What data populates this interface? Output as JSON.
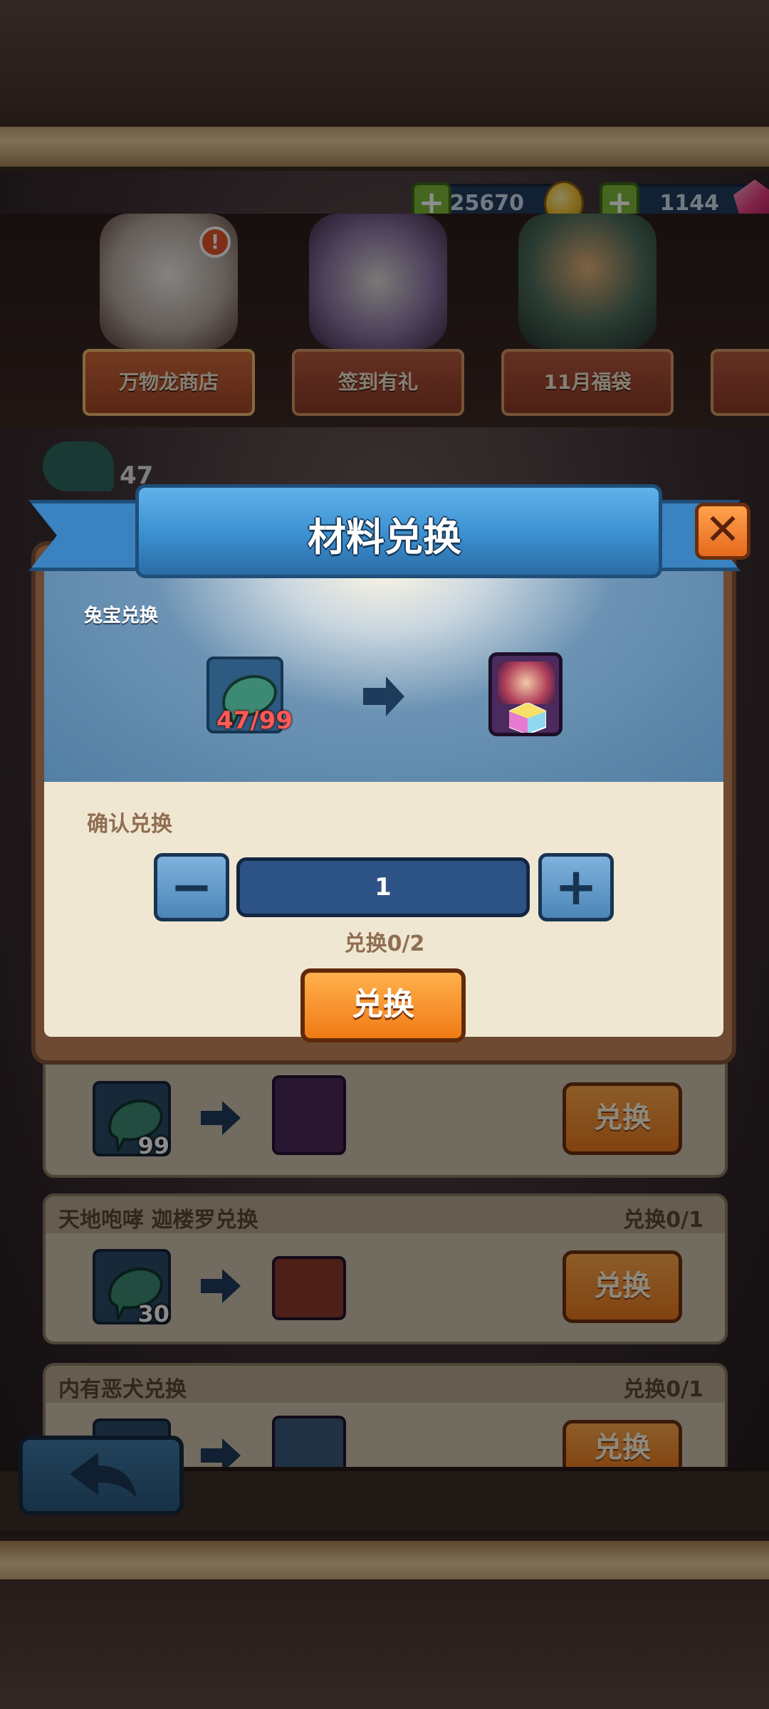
{
  "currency": {
    "gold": "25670",
    "gems": "1144"
  },
  "tabs": [
    {
      "label": "万物龙商店"
    },
    {
      "label": "签到有礼"
    },
    {
      "label": "11月福袋"
    }
  ],
  "alert_badge": "!",
  "background_counter": "47",
  "modal": {
    "title": "材料兑换",
    "close_symbol": "✕",
    "section_label": "兔宝兑换",
    "source_qty": "47/99",
    "confirm_label": "确认兑换",
    "minus_symbol": "−",
    "plus_symbol": "+",
    "quantity": "1",
    "limit": "兑换0/2",
    "exchange_button": "兑换"
  },
  "rows": [
    {
      "title": "",
      "count": "",
      "material_qty": "99",
      "button": "兑换"
    },
    {
      "title": "天地咆哮 迦楼罗兑换",
      "count": "兑换0/1",
      "material_qty": "30",
      "button": "兑换"
    },
    {
      "title": "内有恶犬兑换",
      "count": "兑换0/1",
      "material_qty": "",
      "button": "兑换"
    }
  ],
  "colors": {
    "ribbon_blue": "#3b8fcf",
    "button_orange": "#f07a16",
    "modal_parchment": "#f0e7d2",
    "qty_red": "#ff5a55"
  }
}
